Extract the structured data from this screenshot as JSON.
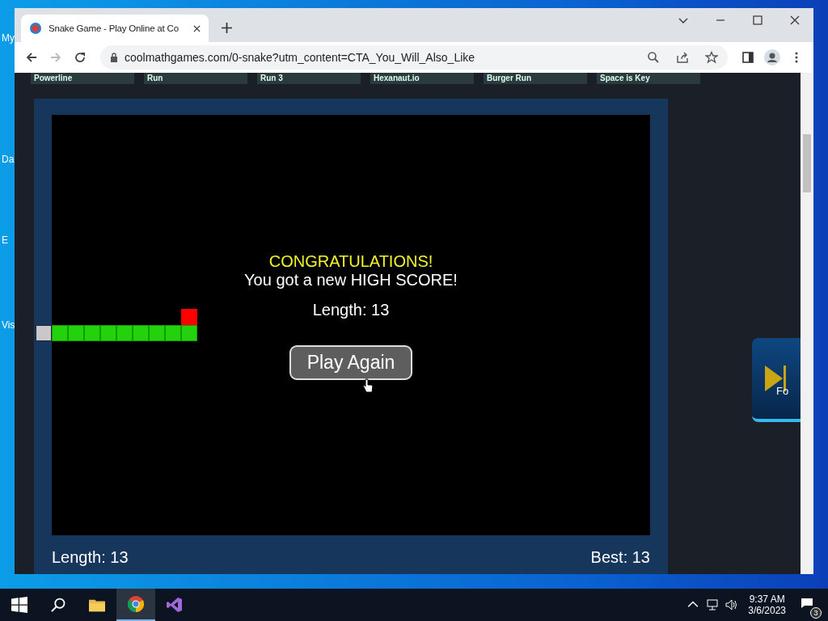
{
  "desktop": {
    "icon_labels": [
      "My",
      "Da",
      "E",
      "Vis"
    ]
  },
  "browser": {
    "tab_title": "Snake Game - Play Online at Co",
    "url": "coolmathgames.com/0-snake?utm_content=CTA_You_Will_Also_Like"
  },
  "game_strip": [
    "Powerline",
    "Run",
    "Run 3",
    "Hexanaut.io",
    "Burger Run",
    "Space is Key"
  ],
  "game": {
    "message_title": "CONGRATULATIONS!",
    "message": "You got a new HIGH SCORE!",
    "length": "Length: 13",
    "play_again": "Play Again",
    "footer_length": "Length: 13",
    "footer_best": "Best: 13"
  },
  "side_ad": {
    "label": "Fo"
  },
  "taskbar": {
    "time": "9:37 AM",
    "date": "3/6/2023",
    "notification_count": "3"
  }
}
